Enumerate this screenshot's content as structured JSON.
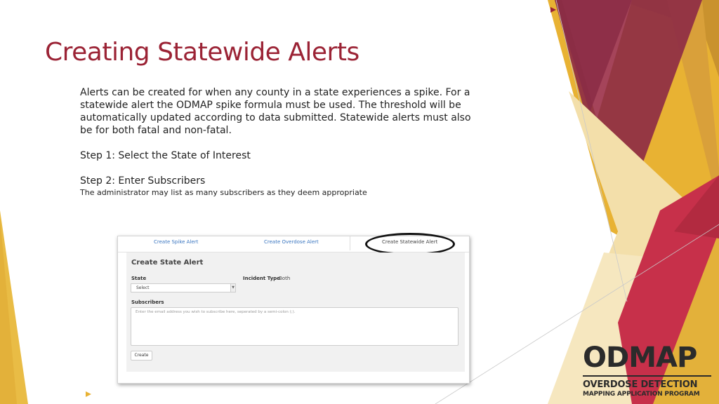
{
  "slide": {
    "title": "Creating Statewide Alerts",
    "paragraph": "Alerts can be created for when any county in a state experiences a spike. For a statewide alert the ODMAP spike formula must be used. The threshold will be automatically updated according to data submitted. Statewide alerts must also be for both fatal and non-fatal.",
    "step1": "Step 1: Select the State of Interest",
    "step2": "Step 2: Enter Subscribers",
    "step2_note": "The administrator may list as many subscribers as they deem appropriate"
  },
  "app": {
    "tabs": [
      {
        "label": "Create Spike Alert"
      },
      {
        "label": "Create Overdose Alert"
      },
      {
        "label": "Create Statewide Alert"
      }
    ],
    "panel_title": "Create State Alert",
    "state_label": "State",
    "state_select_value": "Select",
    "incident_type_label": "Incident Type",
    "incident_type_value": "Both",
    "subscribers_label": "Subscribers",
    "subscribers_placeholder": "Enter the email address you wish to subscribe here, seperated by a semi-colon (;).",
    "create_button": "Create"
  },
  "logo": {
    "main": "ODMAP",
    "line1": "OVERDOSE DETECTION",
    "line2": "MAPPING APPLICATION PROGRAM"
  },
  "colors": {
    "title": "#9b2335",
    "crimson": "#8e2d45",
    "gold": "#e8b233",
    "tan": "#e3c583",
    "cream": "#f3dfaa"
  }
}
